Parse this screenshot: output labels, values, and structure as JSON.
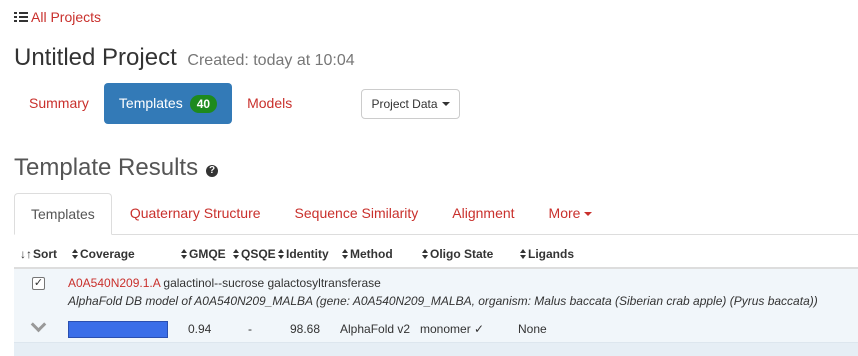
{
  "nav": {
    "all_projects": "All Projects"
  },
  "project": {
    "title": "Untitled Project",
    "created": "Created: today at 10:04"
  },
  "pills": [
    {
      "label": "Summary"
    },
    {
      "label": "Templates",
      "badge": "40"
    },
    {
      "label": "Models"
    }
  ],
  "project_data_button": "Project Data",
  "results_title": "Template Results",
  "help_glyph": "?",
  "tabs": [
    "Templates",
    "Quaternary Structure",
    "Sequence Similarity",
    "Alignment",
    "More"
  ],
  "table": {
    "headers": {
      "sort": "Sort",
      "coverage": "Coverage",
      "gmqe": "GMQE",
      "qsqe": "QSQE",
      "identity": "Identity",
      "method": "Method",
      "oligo_state": "Oligo State",
      "ligands": "Ligands"
    },
    "rows": [
      {
        "checked": true,
        "check_glyph": "✓",
        "accession": "A0A540N209.1.A",
        "name": "galactinol--sucrose galactosyltransferase",
        "description": "AlphaFold DB model of A0A540N209_MALBA (gene: A0A540N209_MALBA, organism: Malus baccata (Siberian crab apple) (Pyrus baccata))",
        "coverage_fraction": 1.0,
        "gmqe": "0.94",
        "qsqe": "-",
        "identity": "98.68",
        "method": "AlphaFold v2",
        "oligo_state": "monomer ✓",
        "ligands": "None"
      }
    ]
  },
  "colors": {
    "link": "#c9302c",
    "active_pill": "#337ab7",
    "badge": "#1e8a1e",
    "coverage_bar": "#3a6ee8",
    "row_bg": "#f1f6fa"
  }
}
